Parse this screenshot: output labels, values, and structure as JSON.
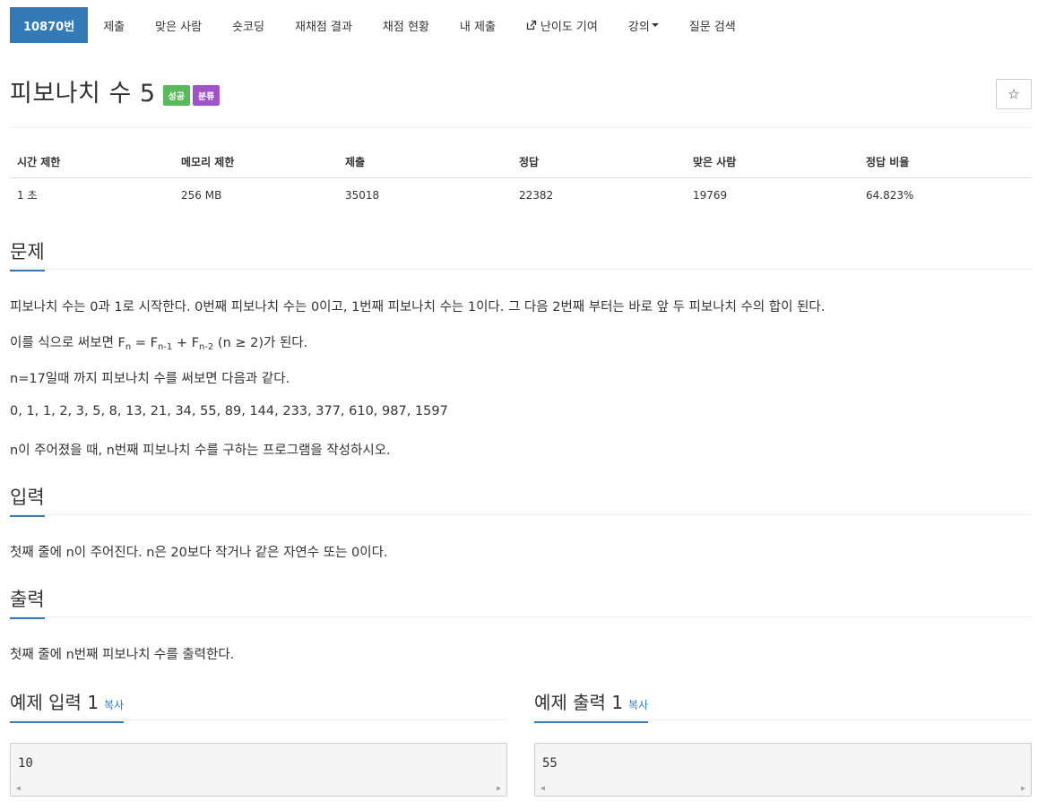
{
  "nav": {
    "items": [
      {
        "label": "10870번"
      },
      {
        "label": "제출"
      },
      {
        "label": "맞은 사람"
      },
      {
        "label": "숏코딩"
      },
      {
        "label": "재채점 결과"
      },
      {
        "label": "채점 현황"
      },
      {
        "label": "내 제출"
      },
      {
        "label": "난이도 기여"
      },
      {
        "label": "강의"
      },
      {
        "label": "질문 검색"
      }
    ]
  },
  "problem": {
    "title": "피보나치 수 5",
    "badge_success": "성공",
    "badge_category": "분류",
    "star": "☆"
  },
  "info": {
    "headers": [
      "시간 제한",
      "메모리 제한",
      "제출",
      "정답",
      "맞은 사람",
      "정답 비율"
    ],
    "values": [
      "1 초",
      "256 MB",
      "35018",
      "22382",
      "19769",
      "64.823%"
    ]
  },
  "description": {
    "heading": "문제",
    "p1": "피보나치 수는 0과 1로 시작한다. 0번째 피보나치 수는 0이고, 1번째 피보나치 수는 1이다. 그 다음 2번째 부터는 바로 앞 두 피보나치 수의 합이 된다.",
    "p2_prefix": "이를 식으로 써보면 F",
    "p2_sub1": "n",
    "p2_eq": " = F",
    "p2_sub2": "n-1",
    "p2_plus": " + F",
    "p2_sub3": "n-2",
    "p2_suffix": " (n ≥ 2)가 된다.",
    "p3": "n=17일때 까지 피보나치 수를 써보면 다음과 같다.",
    "p4": "0, 1, 1, 2, 3, 5, 8, 13, 21, 34, 55, 89, 144, 233, 377, 610, 987, 1597",
    "p5": "n이 주어졌을 때, n번째 피보나치 수를 구하는 프로그램을 작성하시오."
  },
  "input": {
    "heading": "입력",
    "text": "첫째 줄에 n이 주어진다. n은 20보다 작거나 같은 자연수 또는 0이다."
  },
  "output": {
    "heading": "출력",
    "text": "첫째 줄에 n번째 피보나치 수를 출력한다."
  },
  "samples": {
    "input_heading": "예제 입력 1",
    "output_heading": "예제 출력 1",
    "copy_label": "복사",
    "input_value": "10",
    "output_value": "55"
  }
}
